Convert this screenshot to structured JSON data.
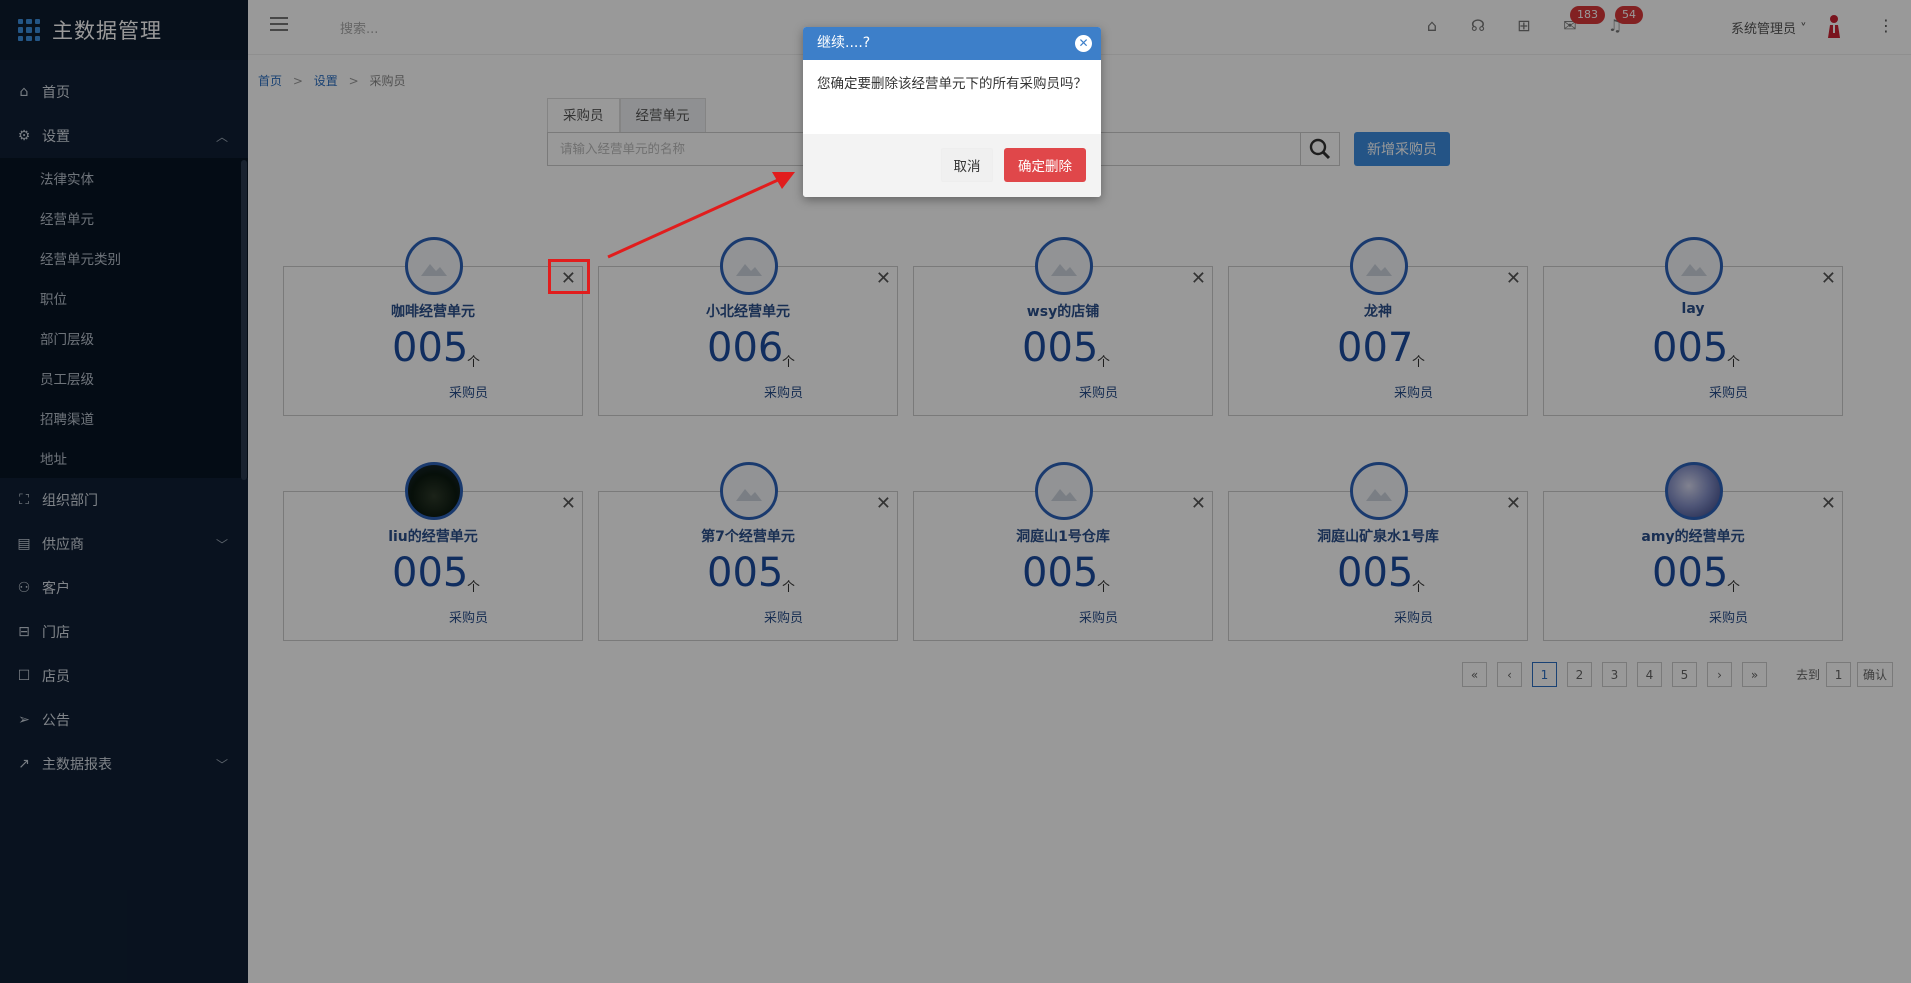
{
  "app": {
    "title": "主数据管理"
  },
  "sidebar": {
    "items": [
      {
        "label": "首页",
        "icon": "home-icon"
      },
      {
        "label": "设置",
        "icon": "gear-icon",
        "expanded": true
      },
      {
        "label": "组织部门",
        "icon": "org-icon"
      },
      {
        "label": "供应商",
        "icon": "supplier-icon"
      },
      {
        "label": "客户",
        "icon": "customer-icon"
      },
      {
        "label": "门店",
        "icon": "store-icon"
      },
      {
        "label": "店员",
        "icon": "staff-icon"
      },
      {
        "label": "公告",
        "icon": "announce-icon"
      },
      {
        "label": "主数据报表",
        "icon": "chart-icon"
      }
    ],
    "settings_children": [
      "法律实体",
      "经营单元",
      "经营单元类别",
      "职位",
      "部门层级",
      "员工层级",
      "招聘渠道",
      "地址"
    ]
  },
  "topbar": {
    "search_placeholder": "搜索...",
    "badge_mail": "183",
    "badge_bell": "54",
    "user": "系统管理员"
  },
  "breadcrumb": {
    "home": "首页",
    "settings": "设置",
    "current": "采购员",
    "sep": ">"
  },
  "tabs": [
    {
      "label": "采购员",
      "active": false
    },
    {
      "label": "经营单元",
      "active": true
    }
  ],
  "search": {
    "placeholder": "请输入经营单元的名称"
  },
  "add_button": "新增采购员",
  "cards": [
    {
      "name": "咖啡经营单元",
      "count": "005",
      "unit": "个",
      "label": "采购员"
    },
    {
      "name": "小北经营单元",
      "count": "006",
      "unit": "个",
      "label": "采购员"
    },
    {
      "name": "wsy的店铺",
      "count": "005",
      "unit": "个",
      "label": "采购员"
    },
    {
      "name": "龙神",
      "count": "007",
      "unit": "个",
      "label": "采购员"
    },
    {
      "name": "lay",
      "count": "005",
      "unit": "个",
      "label": "采购员"
    },
    {
      "name": "liu的经营单元",
      "count": "005",
      "unit": "个",
      "label": "采购员"
    },
    {
      "name": "第7个经营单元",
      "count": "005",
      "unit": "个",
      "label": "采购员"
    },
    {
      "name": "洞庭山1号仓库",
      "count": "005",
      "unit": "个",
      "label": "采购员"
    },
    {
      "name": "洞庭山矿泉水1号库",
      "count": "005",
      "unit": "个",
      "label": "采购员"
    },
    {
      "name": "amy的经营单元",
      "count": "005",
      "unit": "个",
      "label": "采购员"
    }
  ],
  "pagination": {
    "first": "«",
    "prev": "‹",
    "pages": [
      "1",
      "2",
      "3",
      "4",
      "5"
    ],
    "next": "›",
    "last": "»",
    "goto_label": "去到",
    "goto_value": "1",
    "confirm": "确认"
  },
  "modal": {
    "title": "继续....?",
    "message": "您确定要删除该经营单元下的所有采购员吗？",
    "cancel": "取消",
    "confirm": "确定删除"
  }
}
